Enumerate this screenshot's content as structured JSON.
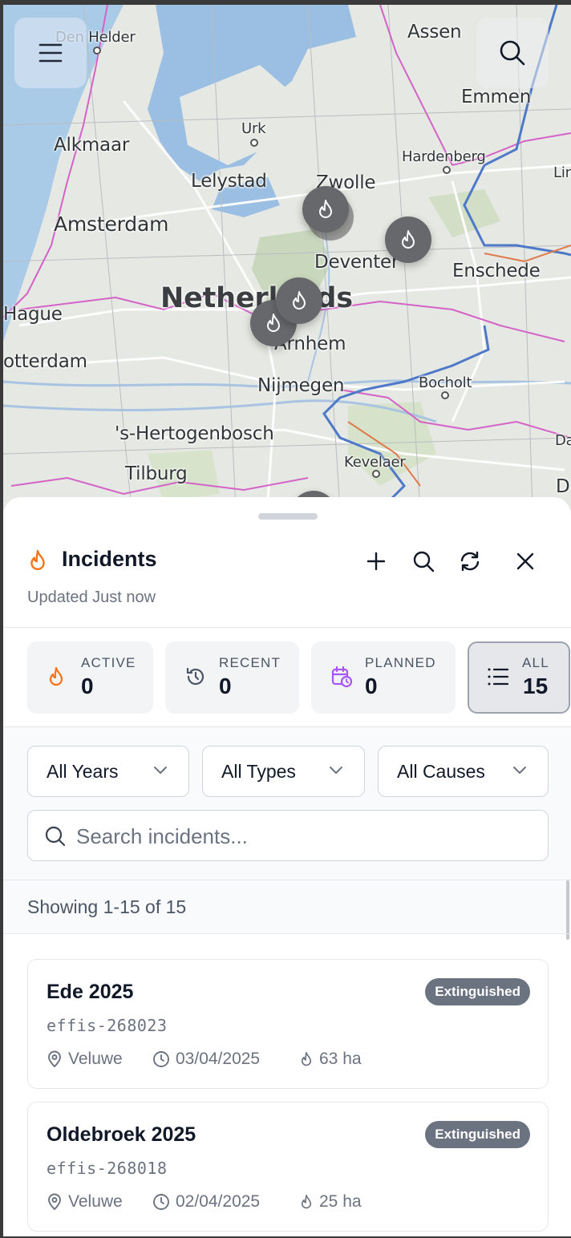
{
  "map": {
    "labels": {
      "den_helder": "Den Helder",
      "assen": "Assen",
      "emmen": "Emmen",
      "alkmaar": "Alkmaar",
      "urk": "Urk",
      "hardenberg": "Hardenberg",
      "lelystad": "Lelystad",
      "zwolle": "Zwolle",
      "lin": "Lin",
      "amsterdam": "Amsterdam",
      "deventer": "Deventer",
      "enschede": "Enschede",
      "netherlands": "Netherlands",
      "hague": "Hague",
      "arnhem": "Arnhem",
      "otterdam": "otterdam",
      "nijmegen": "Nijmegen",
      "bocholt": "Bocholt",
      "den_bosch": "'s-Hertogenbosch",
      "da": "Da",
      "kevelaer": "Kevelaer",
      "tilburg": "Tilburg",
      "d": "D"
    },
    "menu_icon": "hamburger-menu-icon",
    "search_icon": "search-icon",
    "marker_icon": "flame-icon",
    "marker_count": 5
  },
  "panel": {
    "title": "Incidents",
    "title_icon": "flame-icon",
    "updated": "Updated Just now",
    "actions": [
      "plus-icon",
      "search-icon",
      "refresh-icon",
      "close-icon"
    ],
    "stats": [
      {
        "label": "ACTIVE",
        "value": "0",
        "icon": "flame-icon"
      },
      {
        "label": "RECENT",
        "value": "0",
        "icon": "history-icon"
      },
      {
        "label": "PLANNED",
        "value": "0",
        "icon": "calendar-clock-icon"
      },
      {
        "label": "ALL",
        "value": "15",
        "icon": "list-icon",
        "selected": true
      }
    ],
    "filters": {
      "year": "All Years",
      "type": "All Types",
      "cause": "All Causes"
    },
    "search": {
      "placeholder": "Search incidents...",
      "value": ""
    },
    "showing": "Showing 1-15 of 15",
    "incidents": [
      {
        "title": "Ede 2025",
        "id": "effis-268023",
        "status": "Extinguished",
        "region": "Veluwe",
        "date": "03/04/2025",
        "area": "63 ha"
      },
      {
        "title": "Oldebroek 2025",
        "id": "effis-268018",
        "status": "Extinguished",
        "region": "Veluwe",
        "date": "02/04/2025",
        "area": "25 ha"
      }
    ],
    "colors": {
      "flame_accent": "#f97316",
      "planned_accent": "#a855f7",
      "badge": "#6b7280",
      "marker": "#66686b"
    }
  }
}
